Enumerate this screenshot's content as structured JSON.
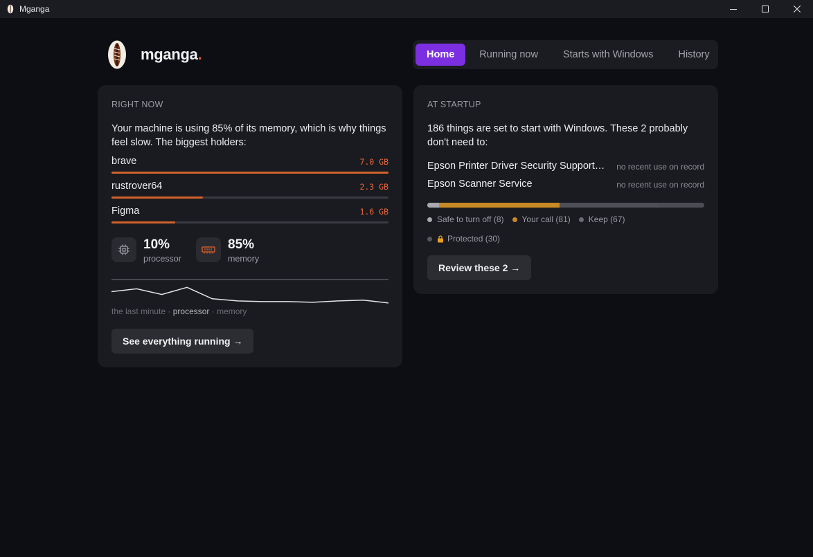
{
  "window": {
    "title": "Mganga"
  },
  "brand": {
    "name": "mganga",
    "dot": ".",
    "accent": "#e0642a"
  },
  "nav": {
    "tabs": [
      {
        "label": "Home",
        "active": true
      },
      {
        "label": "Running now",
        "active": false
      },
      {
        "label": "Starts with Windows",
        "active": false
      },
      {
        "label": "History",
        "active": false
      }
    ],
    "active_color": "#7b2fe0"
  },
  "right_now": {
    "kicker": "RIGHT NOW",
    "lede": "Your machine is using 85% of its memory, which is why things feel slow. The biggest holders:",
    "processes": [
      {
        "name": "brave",
        "size": "7.0 GB",
        "fraction": 1.0
      },
      {
        "name": "rustrover64",
        "size": "2.3 GB",
        "fraction": 0.33
      },
      {
        "name": "Figma",
        "size": "1.6 GB",
        "fraction": 0.23
      }
    ],
    "processor": {
      "value": "10%",
      "label": "processor",
      "icon": "cpu-icon"
    },
    "memory": {
      "value": "85%",
      "label": "memory",
      "icon": "ram-icon"
    },
    "sparkline": {
      "caption_prefix": "the last minute · ",
      "caption_processor": "processor",
      "caption_suffix": " · memory",
      "memory_series": [
        85,
        85,
        85,
        85,
        85,
        85,
        85,
        85,
        85,
        85,
        85,
        85
      ],
      "processor_series": [
        18,
        22,
        14,
        24,
        8,
        5,
        4,
        4,
        3,
        5,
        6,
        2
      ]
    },
    "button": "See everything running →"
  },
  "at_startup": {
    "kicker": "AT STARTUP",
    "lede": "186 things are set to start with Windows. These 2 probably don't need to:",
    "items": [
      {
        "name": "Epson Printer Driver Security Support T...",
        "note": "no recent use on record"
      },
      {
        "name": "Epson Scanner Service",
        "note": "no recent use on record"
      }
    ],
    "breakdown": [
      {
        "label": "Safe to turn off (8)",
        "count": 8,
        "color": "#a9a9ae"
      },
      {
        "label": "Your call (81)",
        "count": 81,
        "color": "#c88a24"
      },
      {
        "label": "Keep (67)",
        "count": 67,
        "color": "#4e4f57"
      },
      {
        "label": "Protected (30)",
        "count": 30,
        "color": "#4b4c54"
      }
    ],
    "button": "Review these 2 →"
  }
}
